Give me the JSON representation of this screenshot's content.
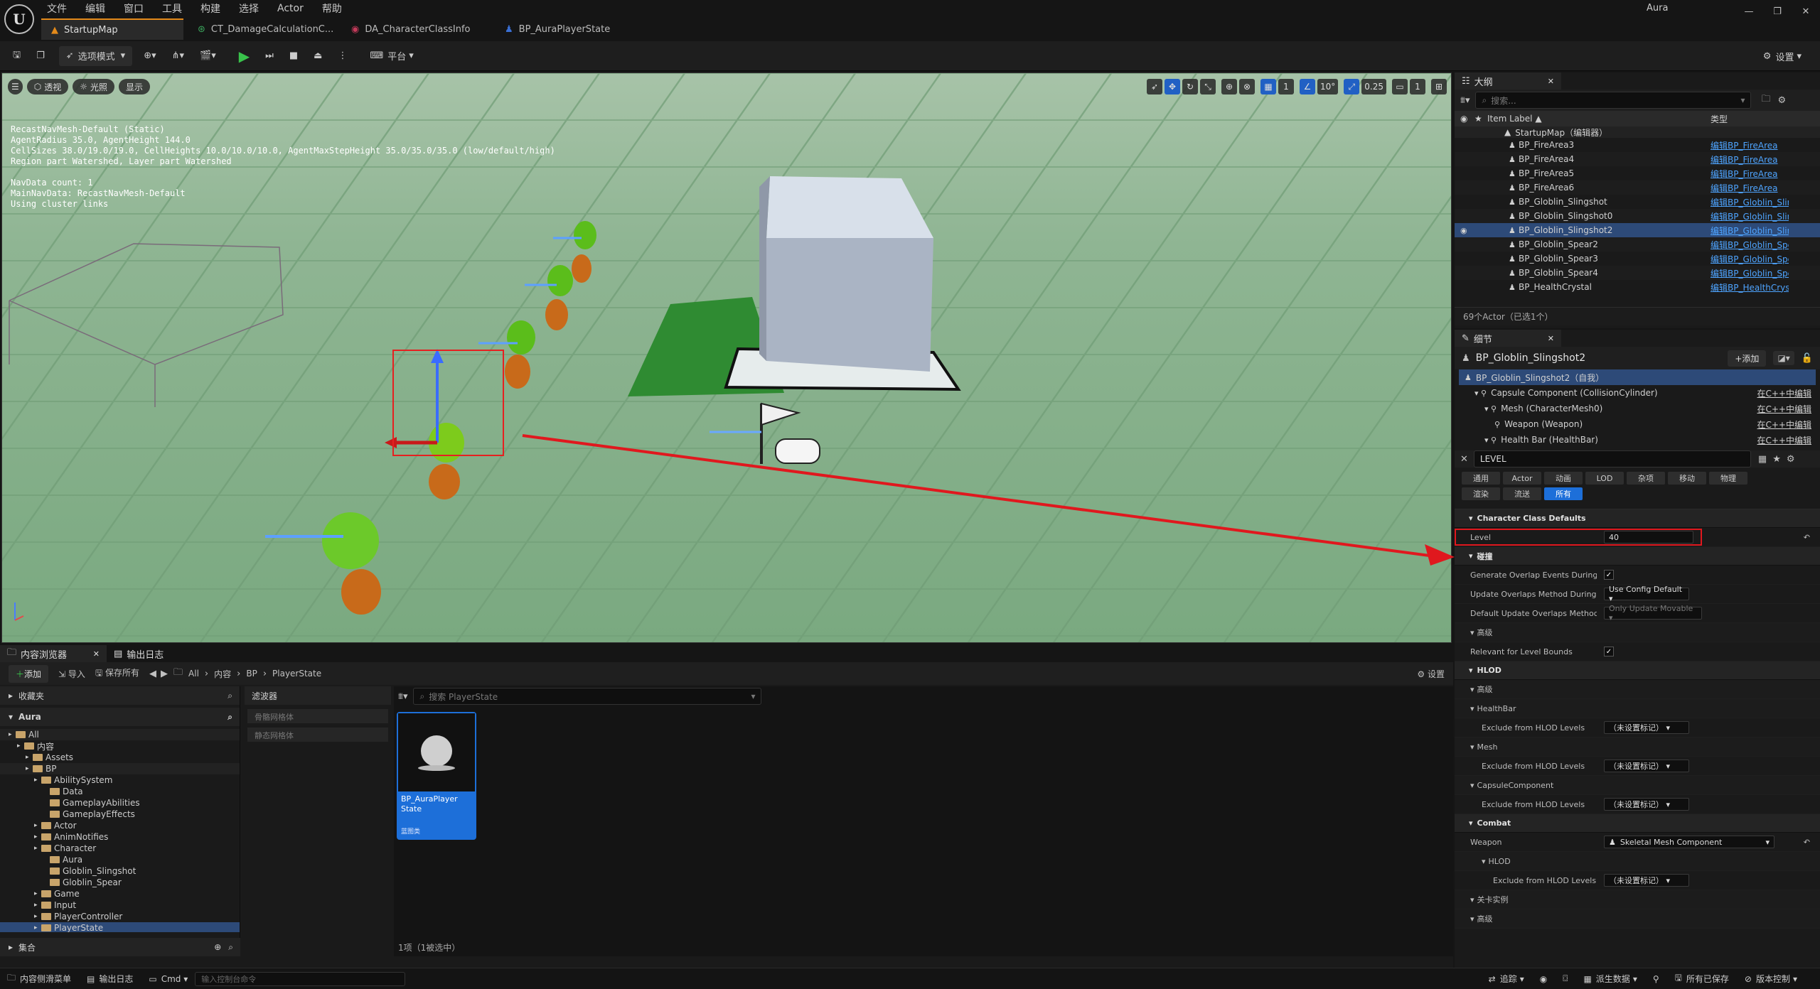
{
  "app": {
    "logo_text": "U",
    "user": "Aura"
  },
  "menu": [
    "文件",
    "编辑",
    "窗口",
    "工具",
    "构建",
    "选择",
    "Actor",
    "帮助"
  ],
  "window_controls": {
    "minimize": "—",
    "maximize": "❐",
    "close": "✕"
  },
  "tabs": [
    {
      "label": "StartupMap",
      "active": true
    },
    {
      "label": "CT_DamageCalculationC...",
      "active": false
    },
    {
      "label": "DA_CharacterClassInfo",
      "active": false
    },
    {
      "label": "BP_AuraPlayerState",
      "active": false
    }
  ],
  "toolbar": {
    "mode": "选项模式",
    "platform": "平台",
    "settings": "设置"
  },
  "viewport": {
    "buttons": [
      "透视",
      "光照",
      "显示"
    ],
    "snap_grid": "1",
    "snap_angle": "10°",
    "snap_scale": "0.25",
    "camera_speed": "1",
    "nav_info": "RecastNavMesh-Default (Static)\nAgentRadius 35.0, AgentHeight 144.0\nCellSizes 38.0/19.0/19.0, CellHeights 10.0/10.0/10.0, AgentMaxStepHeight 35.0/35.0/35.0 (low/default/high)\nRegion part Watershed, Layer part Watershed\n\nNavData count: 1\nMainNavData: RecastNavMesh-Default\nUsing cluster links"
  },
  "outliner": {
    "tab": "大纲",
    "search_placeholder": "搜索...",
    "col_label": "Item Label ▲",
    "col_type": "类型",
    "root": "StartupMap（编辑器）",
    "rows": [
      {
        "label": "BP_FireArea3",
        "type": "编辑BP_FireArea"
      },
      {
        "label": "BP_FireArea4",
        "type": "编辑BP_FireArea"
      },
      {
        "label": "BP_FireArea5",
        "type": "编辑BP_FireArea"
      },
      {
        "label": "BP_FireArea6",
        "type": "编辑BP_FireArea"
      },
      {
        "label": "BP_Globlin_Slingshot",
        "type": "编辑BP_Globlin_Sling"
      },
      {
        "label": "BP_Globlin_Slingshot0",
        "type": "编辑BP_Globlin_Sling"
      },
      {
        "label": "BP_Globlin_Slingshot2",
        "type": "编辑BP_Globlin_Sling"
      },
      {
        "label": "BP_Globlin_Spear2",
        "type": "编辑BP_Globlin_Spe"
      },
      {
        "label": "BP_Globlin_Spear3",
        "type": "编辑BP_Globlin_Spe"
      },
      {
        "label": "BP_Globlin_Spear4",
        "type": "编辑BP_Globlin_Spe"
      },
      {
        "label": "BP_HealthCrystal",
        "type": "编辑BP_HealthCryst"
      }
    ],
    "count": "69个Actor（已选1个）"
  },
  "details": {
    "tab": "细节",
    "actor_name": "BP_Globlin_Slingshot2",
    "add_button": "+添加",
    "components": [
      {
        "label": "BP_Globlin_Slingshot2（自我）",
        "edit": "",
        "indent": 0
      },
      {
        "label": "Capsule Component (CollisionCylinder)",
        "edit": "在C++中编辑",
        "indent": 1
      },
      {
        "label": "Mesh (CharacterMesh0)",
        "edit": "在C++中编辑",
        "indent": 2
      },
      {
        "label": "Weapon (Weapon)",
        "edit": "在C++中编辑",
        "indent": 3
      },
      {
        "label": "Health Bar (HealthBar)",
        "edit": "在C++中编辑",
        "indent": 2
      }
    ],
    "search_value": "LEVEL",
    "categories": [
      "通用",
      "Actor",
      "动画",
      "LOD",
      "杂项",
      "移动",
      "物理",
      "渲染",
      "流送",
      "所有"
    ],
    "sections": [
      {
        "type": "section",
        "label": "Character Class Defaults"
      },
      {
        "type": "prop",
        "label": "Level",
        "value": "40",
        "kind": "input",
        "highlight": true
      },
      {
        "type": "section",
        "label": "碰撞"
      },
      {
        "type": "prop",
        "label": "Generate Overlap Events During...",
        "kind": "check",
        "value": "✓"
      },
      {
        "type": "prop",
        "label": "Update Overlaps Method During...",
        "kind": "dropdown",
        "value": "Use Config Default ▾"
      },
      {
        "type": "prop",
        "label": "Default Update Overlaps Method...",
        "kind": "dropdown-disabled",
        "value": "Only Update Movable ▾"
      },
      {
        "type": "sub",
        "label": "高级"
      },
      {
        "type": "prop",
        "label": "Relevant for Level Bounds",
        "kind": "check",
        "value": "✓"
      },
      {
        "type": "section",
        "label": "HLOD"
      },
      {
        "type": "sub",
        "label": "高级"
      },
      {
        "type": "sub",
        "label": "HealthBar"
      },
      {
        "type": "prop",
        "label": "Exclude from HLOD Levels",
        "kind": "dropdown",
        "value": "（未设置标记） ▾",
        "indent": 1
      },
      {
        "type": "sub",
        "label": "Mesh"
      },
      {
        "type": "prop",
        "label": "Exclude from HLOD Levels",
        "kind": "dropdown",
        "value": "（未设置标记） ▾",
        "indent": 1
      },
      {
        "type": "sub",
        "label": "CapsuleComponent"
      },
      {
        "type": "prop",
        "label": "Exclude from HLOD Levels",
        "kind": "dropdown",
        "value": "（未设置标记） ▾",
        "indent": 1
      },
      {
        "type": "section",
        "label": "Combat"
      },
      {
        "type": "prop",
        "label": "Weapon",
        "kind": "dropdown-wide",
        "value": "Skeletal Mesh Component"
      },
      {
        "type": "sub",
        "label": "HLOD",
        "indent": 1
      },
      {
        "type": "prop",
        "label": "Exclude from HLOD Levels",
        "kind": "dropdown",
        "value": "（未设置标记） ▾",
        "indent": 2
      },
      {
        "type": "sub",
        "label": "关卡实例"
      },
      {
        "type": "sub",
        "label": "高级"
      }
    ]
  },
  "content_browser": {
    "tab": "内容浏览器",
    "tab2": "输出日志",
    "add": "添加",
    "import": "导入",
    "save_all": "保存所有",
    "path": [
      "All",
      "内容",
      "BP",
      "PlayerState"
    ],
    "settings": "设置",
    "favorites": "收藏夹",
    "project": "Aura",
    "filters_label": "滤波器",
    "filters": [
      "骨骼网格体",
      "静态网格体"
    ],
    "search_placeholder": "搜索 PlayerState",
    "tree": [
      {
        "label": "All",
        "depth": 0
      },
      {
        "label": "内容",
        "depth": 1
      },
      {
        "label": "Assets",
        "depth": 2
      },
      {
        "label": "BP",
        "depth": 2
      },
      {
        "label": "AbilitySystem",
        "depth": 3
      },
      {
        "label": "Data",
        "depth": 4
      },
      {
        "label": "GameplayAbilities",
        "depth": 4
      },
      {
        "label": "GameplayEffects",
        "depth": 4
      },
      {
        "label": "Actor",
        "depth": 3
      },
      {
        "label": "AnimNotifies",
        "depth": 3
      },
      {
        "label": "Character",
        "depth": 3
      },
      {
        "label": "Aura",
        "depth": 4
      },
      {
        "label": "Globlin_Slingshot",
        "depth": 4
      },
      {
        "label": "Globlin_Spear",
        "depth": 4
      },
      {
        "label": "Game",
        "depth": 3
      },
      {
        "label": "Input",
        "depth": 3
      },
      {
        "label": "PlayerController",
        "depth": 3
      },
      {
        "label": "PlayerState",
        "depth": 3
      }
    ],
    "collections": "集合",
    "asset": {
      "name": "BP_AuraPlayer State",
      "type": "蓝图类"
    },
    "count": "1项（1被选中）"
  },
  "statusbar": {
    "drawer": "内容侧滑菜单",
    "log": "输出日志",
    "cmd": "Cmd ▾",
    "console_placeholder": "输入控制台命令",
    "trace": "追踪",
    "derived": "派生数据",
    "saved": "所有已保存",
    "revision": "版本控制"
  }
}
